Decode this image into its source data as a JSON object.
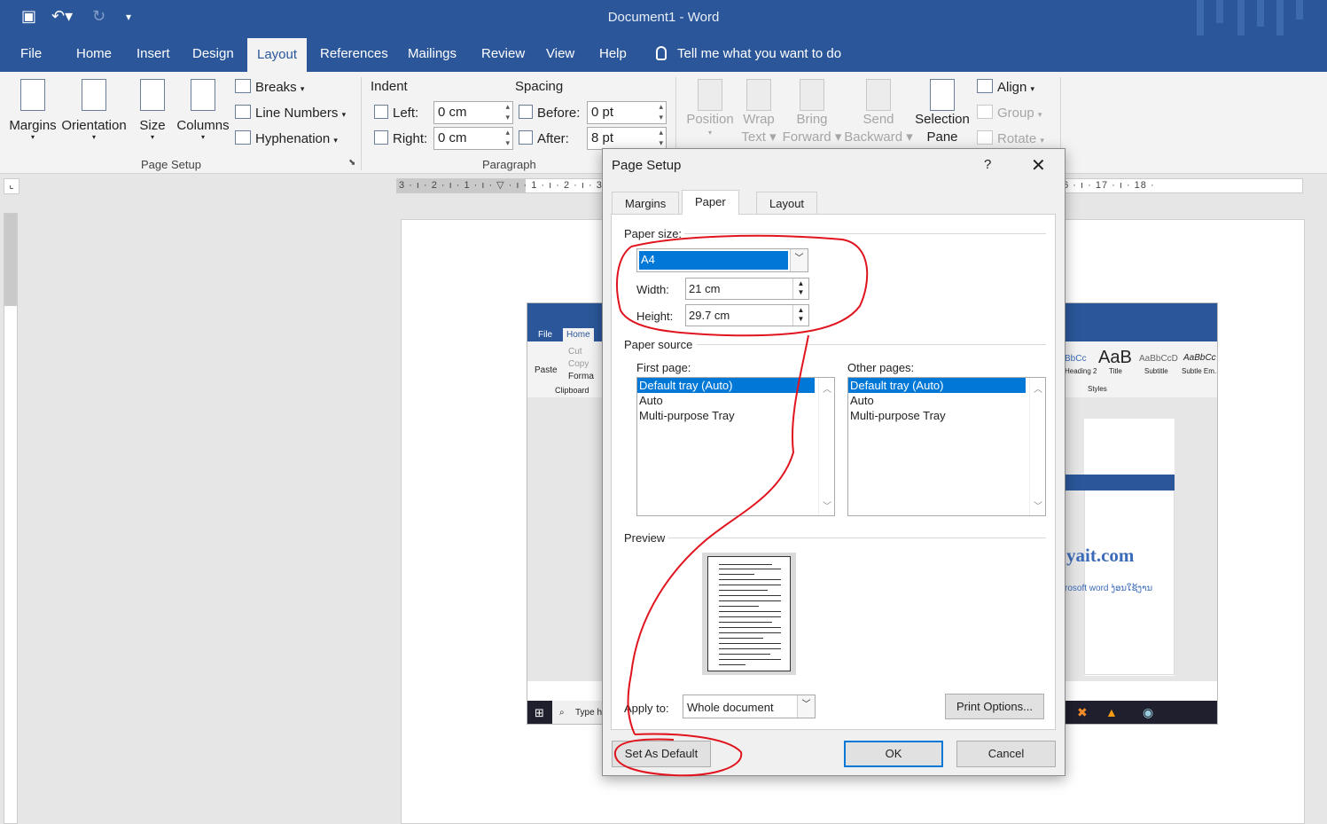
{
  "app": {
    "title": "Document1  -  Word"
  },
  "ribbon_tabs": [
    "File",
    "Home",
    "Insert",
    "Design",
    "Layout",
    "References",
    "Mailings",
    "Review",
    "View",
    "Help"
  ],
  "tell_me": "Tell me what you want to do",
  "ribbon": {
    "margins": "Margins",
    "orientation": "Orientation",
    "size": "Size",
    "columns": "Columns",
    "breaks": "Breaks",
    "line_numbers": "Line Numbers",
    "hyphenation": "Hyphenation",
    "page_setup_group": "Page Setup",
    "indent": "Indent",
    "spacing": "Spacing",
    "left_label": "Left:",
    "right_label": "Right:",
    "before_label": "Before:",
    "after_label": "After:",
    "left_value": "0 cm",
    "right_value": "0 cm",
    "before_value": "0 pt",
    "after_value": "8 pt",
    "paragraph_group": "Paragraph",
    "position": "Position",
    "wrap": "Wrap",
    "text": "Text",
    "bring": "Bring",
    "forward": "Forward",
    "send": "Send",
    "backward": "Backward",
    "selection": "Selection",
    "pane": "Pane",
    "align": "Align",
    "group": "Group",
    "rotate": "Rotate"
  },
  "ruler": "3 · ı · 2 · ı · 1 · ı · ▽ · ı · 1 · ı · 2 · ı · 3 · ı · 4 · ı · 5 · ı · 6 · ı · 7 · ı · 8 · ı · 9 · ı · 10 · ı · 11 · ı · 12 · ı · 13 · ı · 14 · ı · 15 · ı · 16 · ı · 17 · ı · 18 ·",
  "embedded": {
    "file": "File",
    "home": "Home",
    "paste": "Paste",
    "cut": "Cut",
    "copy": "Copy",
    "format": "Forma",
    "clipboard": "Clipboard",
    "heading": "Heading 2",
    "title": "Title",
    "subtitle": "Subtitle",
    "subtle": "Subtle Em...",
    "styles": "Styles",
    "aab": "AaB",
    "abbc": "AaBbCcD",
    "abbc2": "AaBbCc",
    "abbc3": "BbCc",
    "site": "yait.com",
    "sub": "rosoft word ງ່ອນໃຊ້ງານ",
    "typeh": "Type he"
  },
  "dialog": {
    "title": "Page Setup",
    "help": "?",
    "close": "✕",
    "tabs": [
      "Margins",
      "Paper",
      "Layout"
    ],
    "paper_size_label": "Paper size:",
    "paper_size": "A4",
    "width_label": "Width:",
    "width_value": "21 cm",
    "height_label": "Height:",
    "height_value": "29.7 cm",
    "paper_source_label": "Paper source",
    "first_page_label": "First page:",
    "other_pages_label": "Other pages:",
    "first_page_options": [
      "Default tray (Auto)",
      "Auto",
      "Multi-purpose Tray"
    ],
    "other_pages_options": [
      "Default tray (Auto)",
      "Auto",
      "Multi-purpose Tray"
    ],
    "preview_label": "Preview",
    "apply_to_label": "Apply to:",
    "apply_to_value": "Whole document",
    "print_options": "Print Options...",
    "set_default": "Set As Default",
    "ok": "OK",
    "cancel": "Cancel"
  },
  "colors": {
    "titlebar": "#2b579a",
    "annotation": "#e0141e",
    "selection": "#0078d7"
  }
}
